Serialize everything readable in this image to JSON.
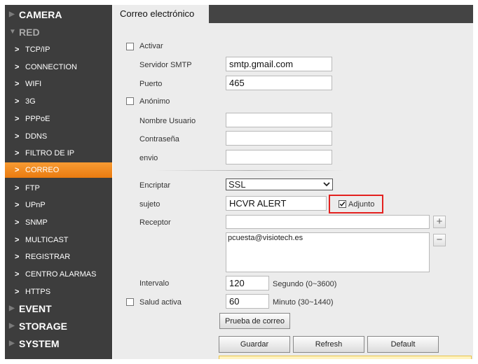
{
  "sidebar": {
    "sections_top": [
      {
        "label": "CAMERA"
      },
      {
        "label": "RED"
      }
    ],
    "items": [
      {
        "label": "TCP/IP"
      },
      {
        "label": "CONNECTION"
      },
      {
        "label": "WIFI"
      },
      {
        "label": "3G"
      },
      {
        "label": "PPPoE"
      },
      {
        "label": "DDNS"
      },
      {
        "label": "FILTRO DE IP"
      },
      {
        "label": "CORREO"
      },
      {
        "label": "FTP"
      },
      {
        "label": "UPnP"
      },
      {
        "label": "SNMP"
      },
      {
        "label": "MULTICAST"
      },
      {
        "label": "REGISTRAR"
      },
      {
        "label": "CENTRO ALARMAS"
      },
      {
        "label": "HTTPS"
      }
    ],
    "sections_bottom": [
      {
        "label": "EVENT"
      },
      {
        "label": "STORAGE"
      },
      {
        "label": "SYSTEM"
      }
    ],
    "active_item": "CORREO",
    "active_color": "#f28a20"
  },
  "tab": {
    "title": "Correo electrónico"
  },
  "form": {
    "activar_label": "Activar",
    "activar_checked": false,
    "smtp_label": "Servidor SMTP",
    "smtp_value": "smtp.gmail.com",
    "puerto_label": "Puerto",
    "puerto_value": "465",
    "anonimo_label": "Anónimo",
    "anonimo_checked": false,
    "usuario_label": "Nombre Usuario",
    "usuario_value": "",
    "contrasena_label": "Contraseña",
    "contrasena_value": "",
    "envio_label": "envio",
    "envio_value": "",
    "encriptar_label": "Encriptar",
    "encriptar_value": "SSL",
    "sujeto_label": "sujeto",
    "sujeto_value": "HCVR ALERT",
    "adjunto_label": "Adjunto",
    "adjunto_checked": true,
    "receptor_label": "Receptor",
    "receptor_value": "",
    "receptor_list": "pcuesta@visiotech.es",
    "intervalo_label": "Intervalo",
    "intervalo_value": "120",
    "intervalo_unit": "Segundo (0~3600)",
    "salud_label": "Salud activa",
    "salud_checked": false,
    "salud_value": "60",
    "salud_unit": "Minuto (30~1440)",
    "test_button": "Prueba de correo"
  },
  "buttons": {
    "save": "Guardar",
    "refresh": "Refresh",
    "default": "Default"
  },
  "icons": {
    "add": "plus-icon",
    "remove": "minus-icon"
  }
}
